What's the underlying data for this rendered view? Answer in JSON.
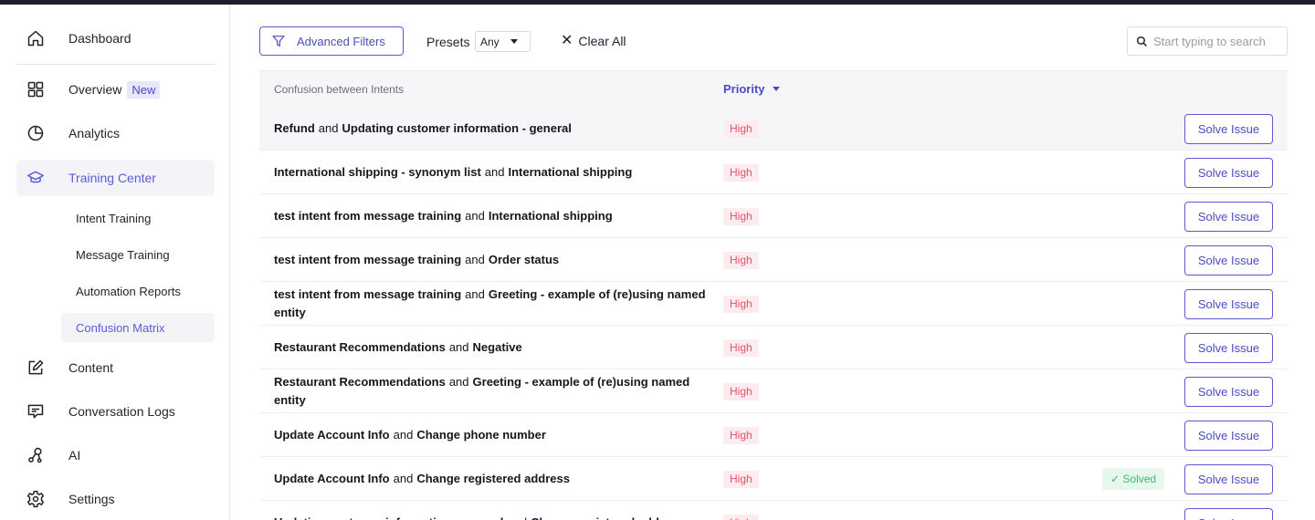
{
  "sidebar": {
    "items": [
      {
        "label": "Dashboard",
        "icon": "home-icon"
      },
      {
        "label": "Overview",
        "badge": "New",
        "icon": "grid-icon"
      },
      {
        "label": "Analytics",
        "icon": "pie-chart-icon"
      },
      {
        "label": "Training Center",
        "icon": "graduation-cap-icon"
      },
      {
        "label": "Content",
        "icon": "edit-icon"
      },
      {
        "label": "Conversation Logs",
        "icon": "chat-icon"
      },
      {
        "label": "AI",
        "icon": "ai-nodes-icon"
      },
      {
        "label": "Settings",
        "icon": "gear-icon"
      }
    ],
    "subitems": [
      {
        "label": "Intent Training"
      },
      {
        "label": "Message Training"
      },
      {
        "label": "Automation Reports"
      },
      {
        "label": "Confusion Matrix"
      }
    ]
  },
  "toolbar": {
    "filters_label": "Advanced Filters",
    "presets_label": "Presets",
    "presets_value": "Any",
    "clear_label": "Clear All",
    "search_placeholder": "Start typing to search"
  },
  "table": {
    "col_pair": "Confusion between Intents",
    "col_priority": "Priority",
    "and_word": "and",
    "solve_label": "Solve Issue",
    "solved_label": "✓ Solved",
    "rows": [
      {
        "a": "Refund",
        "b": "Updating customer information - general",
        "priority": "High"
      },
      {
        "a": "International shipping - synonym list",
        "b": "International shipping",
        "priority": "High"
      },
      {
        "a": "test intent from message training",
        "b": "International shipping",
        "priority": "High"
      },
      {
        "a": "test intent from message training",
        "b": "Order status",
        "priority": "High"
      },
      {
        "a": "test intent from message training",
        "b": "Greeting - example of (re)using named entity",
        "priority": "High"
      },
      {
        "a": "Restaurant Recommendations",
        "b": "Negative",
        "priority": "High"
      },
      {
        "a": "Restaurant Recommendations",
        "b": "Greeting - example of (re)using named entity",
        "priority": "High"
      },
      {
        "a": "Update Account Info",
        "b": "Change phone number",
        "priority": "High"
      },
      {
        "a": "Update Account Info",
        "b": "Change registered address",
        "priority": "High",
        "solved": true
      },
      {
        "a": "Updating customer information - general",
        "b": "Change registered address",
        "priority": "High"
      }
    ]
  }
}
